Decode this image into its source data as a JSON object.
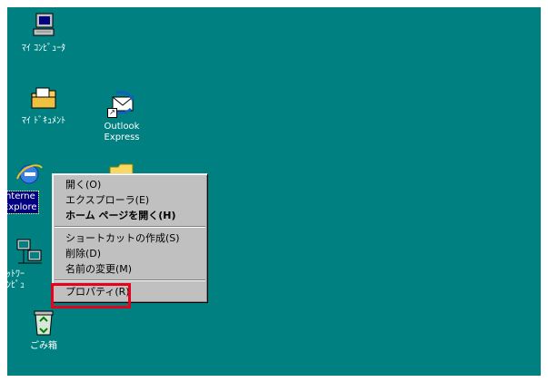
{
  "desktop": {
    "background": "#008080",
    "icons": [
      {
        "name": "my-computer",
        "label": "ﾏｲ ｺﾝﾋﾟｭｰﾀ"
      },
      {
        "name": "my-documents",
        "label": "ﾏｲ ﾄﾞｷｭﾒﾝﾄ"
      },
      {
        "name": "outlook-express",
        "label": "Outlook\nExpress"
      },
      {
        "name": "internet-explorer",
        "label": "Interne\nExplore"
      },
      {
        "name": "network",
        "label": "ﾈｯﾄﾜｰ\nｺﾝﾋﾟｭ"
      },
      {
        "name": "recycle-bin",
        "label": "ごみ箱"
      }
    ]
  },
  "context_menu": {
    "group1": [
      {
        "label": "開く(O)",
        "bold": false
      },
      {
        "label": "エクスプローラ(E)",
        "bold": false
      },
      {
        "label": "ホーム ページを開く(H)",
        "bold": true
      }
    ],
    "group2": [
      {
        "label": "ショートカットの作成(S)"
      },
      {
        "label": "削除(D)"
      },
      {
        "label": "名前の変更(M)"
      }
    ],
    "group3": [
      {
        "label": "プロパティ(R)"
      }
    ]
  },
  "highlight_color": "#e8001c"
}
